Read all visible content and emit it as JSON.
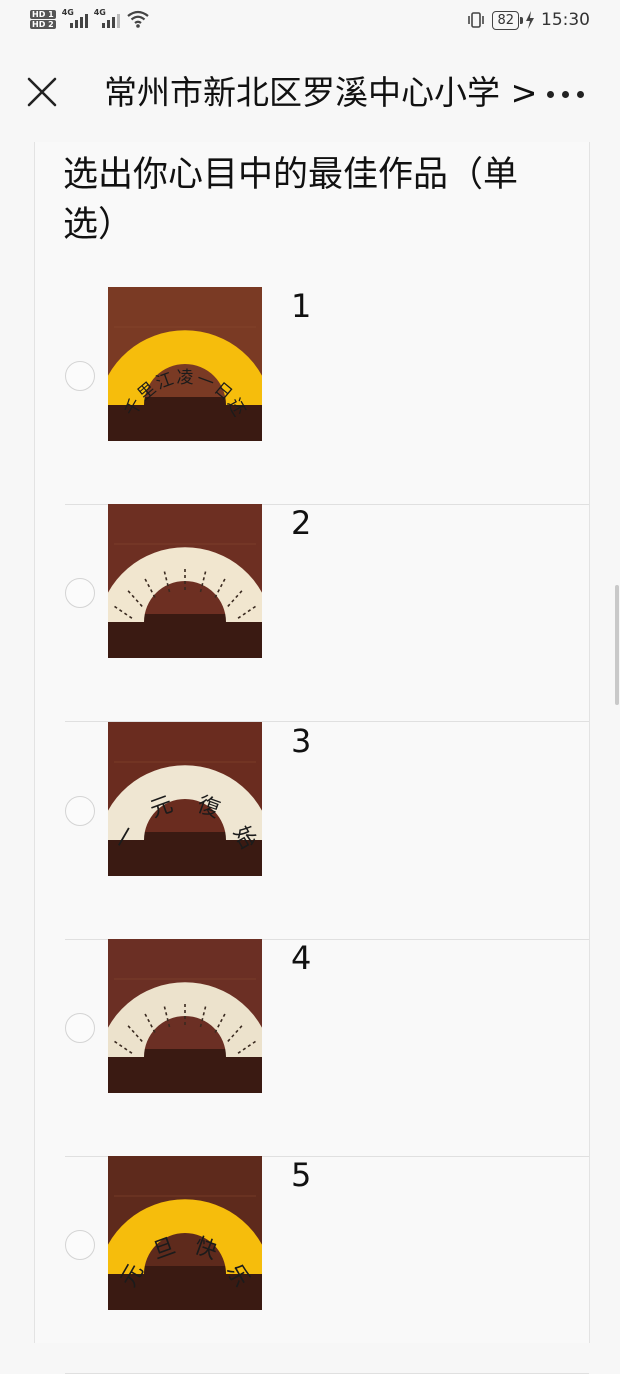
{
  "status_bar": {
    "sim1": "HD 1",
    "sim2": "HD 2",
    "net1": "4G",
    "net2": "4G",
    "battery": "82",
    "time": "15:30"
  },
  "header": {
    "title": "常州市新北区罗溪中心小学 >",
    "icons": [
      "close-icon",
      "more-icon"
    ]
  },
  "question": {
    "text": "选出你心目中的最佳作品（单选）"
  },
  "options": [
    {
      "label": "1",
      "fan_color": "#f6bd0c",
      "fan_text": "千里江凌一日还"
    },
    {
      "label": "2",
      "fan_color": "#f1e6cf",
      "fan_text": ""
    },
    {
      "label": "3",
      "fan_color": "#efe6d2",
      "fan_text": "一元復始"
    },
    {
      "label": "4",
      "fan_color": "#ece2cc",
      "fan_text": ""
    },
    {
      "label": "5",
      "fan_color": "#f6bd0c",
      "fan_text": "元旦快乐"
    }
  ]
}
